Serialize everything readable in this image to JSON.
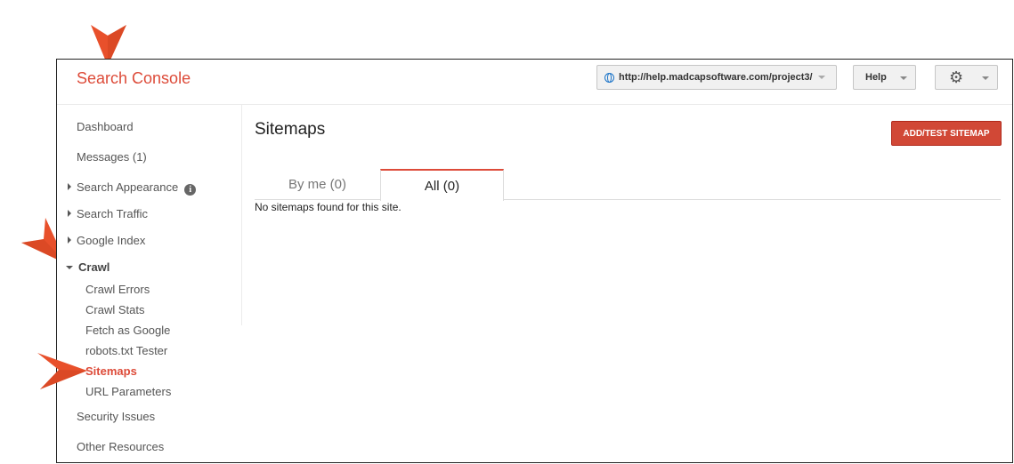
{
  "header": {
    "brand": "Search Console",
    "site_url": "http://help.madcapsoftware.com/project3/",
    "help_label": "Help",
    "settings_icon": "gear-icon"
  },
  "sidebar": {
    "dashboard": "Dashboard",
    "messages": "Messages (1)",
    "search_appearance": "Search Appearance",
    "search_traffic": "Search Traffic",
    "google_index": "Google Index",
    "crawl": "Crawl",
    "crawl_errors": "Crawl Errors",
    "crawl_stats": "Crawl Stats",
    "fetch_as_google": "Fetch as Google",
    "robots_tester": "robots.txt Tester",
    "sitemaps": "Sitemaps",
    "url_parameters": "URL Parameters",
    "security_issues": "Security Issues",
    "other_resources": "Other Resources"
  },
  "main": {
    "title": "Sitemaps",
    "add_button": "ADD/TEST SITEMAP",
    "tabs": [
      {
        "label": "By me (0)",
        "active": false
      },
      {
        "label": "All (0)",
        "active": true
      }
    ],
    "empty_message": "No sitemaps found for this site."
  },
  "colors": {
    "accent": "#dd4b39",
    "callout_arrow": "#e8502b"
  }
}
